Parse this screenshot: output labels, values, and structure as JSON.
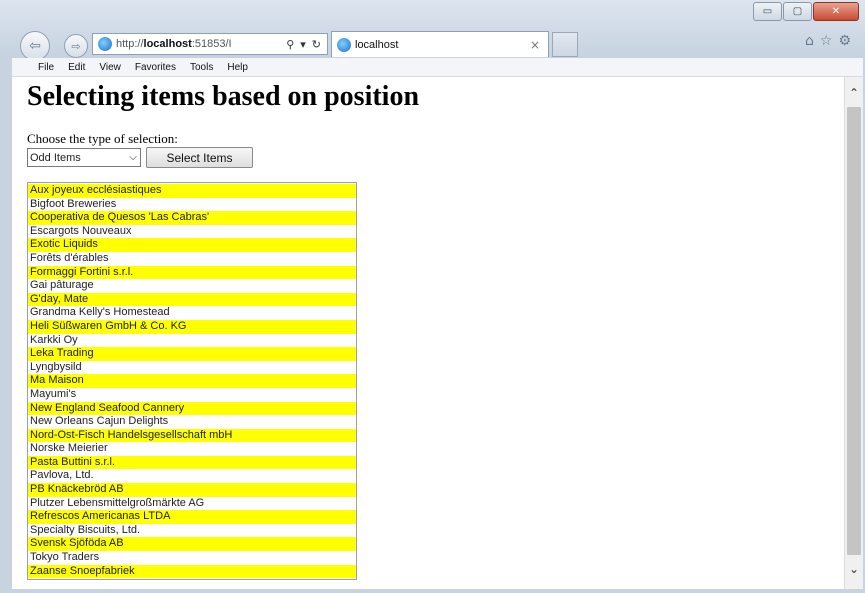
{
  "browser": {
    "url_prefix": "http://",
    "url_host": "localhost",
    "url_rest": ":51853/I",
    "tab_title": "localhost",
    "address_tools": {
      "search": "⚲",
      "dropdown": "▾",
      "refresh": "↻"
    },
    "tab_close": "×",
    "window_controls": {
      "minimize": "▭",
      "maximize": "▢",
      "close": "✕"
    },
    "right_icons": [
      "home-icon",
      "favorites-star-icon",
      "settings-gear-icon"
    ]
  },
  "menubar": {
    "items": [
      "File",
      "Edit",
      "View",
      "Favorites",
      "Tools",
      "Help"
    ]
  },
  "page": {
    "title": "Selecting items based on position",
    "choose_label": "Choose the type of selection:",
    "selection_value": "Odd Items",
    "select_button_label": "Select Items"
  },
  "colors": {
    "highlight": "#ffff00"
  },
  "suppliers": [
    {
      "name": "Aux joyeux ecclésiastiques",
      "highlighted": true
    },
    {
      "name": "Bigfoot Breweries",
      "highlighted": false
    },
    {
      "name": "Cooperativa de Quesos 'Las Cabras'",
      "highlighted": true
    },
    {
      "name": "Escargots Nouveaux",
      "highlighted": false
    },
    {
      "name": "Exotic Liquids",
      "highlighted": true
    },
    {
      "name": "Forêts d'érables",
      "highlighted": false
    },
    {
      "name": "Formaggi Fortini s.r.l.",
      "highlighted": true
    },
    {
      "name": "Gai pâturage",
      "highlighted": false
    },
    {
      "name": "G'day, Mate",
      "highlighted": true
    },
    {
      "name": "Grandma Kelly's Homestead",
      "highlighted": false
    },
    {
      "name": "Heli Süßwaren GmbH & Co. KG",
      "highlighted": true
    },
    {
      "name": "Karkki Oy",
      "highlighted": false
    },
    {
      "name": "Leka Trading",
      "highlighted": true
    },
    {
      "name": "Lyngbysild",
      "highlighted": false
    },
    {
      "name": "Ma Maison",
      "highlighted": true
    },
    {
      "name": "Mayumi's",
      "highlighted": false
    },
    {
      "name": "New England Seafood Cannery",
      "highlighted": true
    },
    {
      "name": "New Orleans Cajun Delights",
      "highlighted": false
    },
    {
      "name": "Nord-Ost-Fisch Handelsgesellschaft mbH",
      "highlighted": true
    },
    {
      "name": "Norske Meierier",
      "highlighted": false
    },
    {
      "name": "Pasta Buttini s.r.l.",
      "highlighted": true
    },
    {
      "name": "Pavlova, Ltd.",
      "highlighted": false
    },
    {
      "name": "PB Knäckebröd AB",
      "highlighted": true
    },
    {
      "name": "Plutzer Lebensmittelgroßmärkte AG",
      "highlighted": false
    },
    {
      "name": "Refrescos Americanas LTDA",
      "highlighted": true
    },
    {
      "name": "Specialty Biscuits, Ltd.",
      "highlighted": false
    },
    {
      "name": "Svensk Sjöföda AB",
      "highlighted": true
    },
    {
      "name": "Tokyo Traders",
      "highlighted": false
    },
    {
      "name": "Zaanse Snoepfabriek",
      "highlighted": true
    }
  ]
}
